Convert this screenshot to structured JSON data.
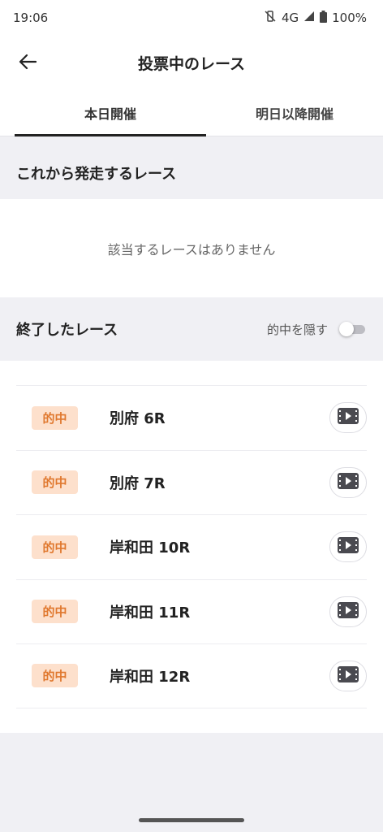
{
  "status": {
    "time": "19:06",
    "network": "4G",
    "battery": "100%"
  },
  "appbar": {
    "title": "投票中のレース"
  },
  "tabs": [
    {
      "label": "本日開催",
      "active": true
    },
    {
      "label": "明日以降開催",
      "active": false
    }
  ],
  "upcoming": {
    "title": "これから発走するレース",
    "empty_message": "該当するレースはありません"
  },
  "finished": {
    "title": "終了したレース",
    "toggle_label": "的中を隠す",
    "toggle_on": false,
    "races": [
      {
        "badge": "的中",
        "name": "別府 6R"
      },
      {
        "badge": "的中",
        "name": "別府 7R"
      },
      {
        "badge": "的中",
        "name": "岸和田 10R"
      },
      {
        "badge": "的中",
        "name": "岸和田 11R"
      },
      {
        "badge": "的中",
        "name": "岸和田 12R"
      }
    ]
  },
  "colors": {
    "badge_bg": "#fde0cc",
    "badge_text": "#e0782e",
    "section_bg": "#f0f0f4"
  }
}
